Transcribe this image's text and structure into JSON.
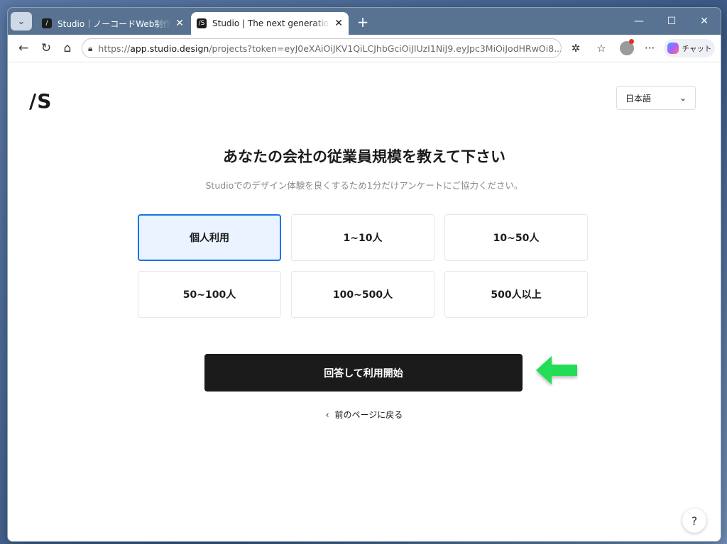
{
  "browser": {
    "tabs": [
      {
        "title": "Studio｜ノーコードWeb制作プラットフォーム",
        "active": false
      },
      {
        "title": "Studio | The next generation design tool",
        "active": true
      }
    ],
    "new_tab_symbol": "+",
    "close_symbol": "✕",
    "window_controls": {
      "minimize": "—",
      "maximize": "☐",
      "close": "✕"
    },
    "address": {
      "scheme": "https://",
      "host": "app.studio.design",
      "rest": "/projects?token=eyJ0eXAiOiJKV1QiLCJhbGciOiJIUzI1NiJ9.eyJpc3MiOiJodHRwOi8..."
    },
    "chat_label": "チャット"
  },
  "page": {
    "logo": "/S",
    "language": {
      "selected": "日本語"
    },
    "heading": "あなたの会社の従業員規模を教えて下さい",
    "subheading": "Studioでのデザイン体験を良くするため1分だけアンケートにご協力ください。",
    "options": [
      {
        "label": "個人利用",
        "selected": true
      },
      {
        "label": "1~10人",
        "selected": false
      },
      {
        "label": "10~50人",
        "selected": false
      },
      {
        "label": "50~100人",
        "selected": false
      },
      {
        "label": "100~500人",
        "selected": false
      },
      {
        "label": "500人以上",
        "selected": false
      }
    ],
    "submit_label": "回答して利用開始",
    "back_label": "前のページに戻る",
    "help_label": "?"
  },
  "colors": {
    "accent": "#1a73e8",
    "selected_bg": "#eaf3ff",
    "button_bg": "#1b1b1b",
    "arrow": "#22dd55"
  }
}
